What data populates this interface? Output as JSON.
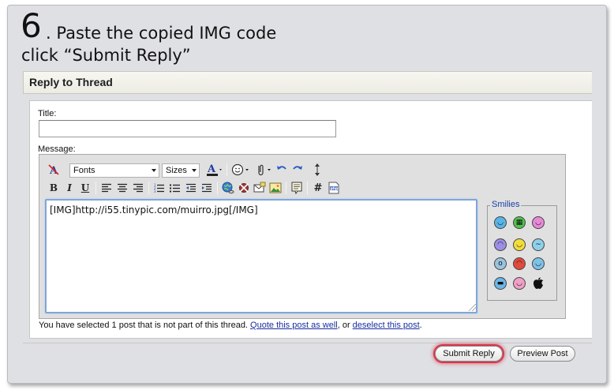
{
  "instruction": {
    "step_number": "6",
    "line1": ". Paste the copied IMG code",
    "line2": "click “Submit Reply”"
  },
  "panel": {
    "title": "Reply to Thread"
  },
  "form": {
    "title_label": "Title:",
    "title_value": "",
    "message_label": "Message:",
    "message_value": "[IMG]http://i55.tinypic.com/muirro.jpg[/IMG]"
  },
  "toolbar": {
    "font_select": "Fonts",
    "size_select": "Sizes",
    "bold": "B",
    "italic": "I",
    "underline": "U",
    "hash": "#"
  },
  "smilies": {
    "title": "Smilies",
    "items": [
      {
        "name": "smile",
        "color": "#5ab4e6",
        "glyph": "◡"
      },
      {
        "name": "grin",
        "color": "#4fc24f",
        "glyph": "▦"
      },
      {
        "name": "tongue",
        "color": "#e58ad6",
        "glyph": "◡"
      },
      {
        "name": "frown",
        "color": "#9b8fe6",
        "glyph": "◠"
      },
      {
        "name": "wink",
        "color": "#f2dd3b",
        "glyph": "◡"
      },
      {
        "name": "confused",
        "color": "#8ed0ea",
        "glyph": "~"
      },
      {
        "name": "eek",
        "color": "#9bc3de",
        "glyph": "o"
      },
      {
        "name": "mad",
        "color": "#e2493c",
        "glyph": "◠"
      },
      {
        "name": "rolleyes",
        "color": "#7ec2e8",
        "glyph": "◡"
      },
      {
        "name": "cool",
        "color": "#6cb6e8",
        "glyph": "▬"
      },
      {
        "name": "redface",
        "color": "#f1a0c8",
        "glyph": "◡"
      },
      {
        "name": "apple",
        "color": "#111111",
        "glyph": ""
      }
    ]
  },
  "notice": {
    "text_before": "You have selected 1 post that is not part of this thread. ",
    "link1": "Quote this post as well",
    "text_middle": ", or ",
    "link2": "deselect this post",
    "text_after": "."
  },
  "buttons": {
    "submit": "Submit Reply",
    "preview": "Preview Post"
  },
  "colors": {
    "focus_ring": "#d9364c",
    "link": "#1a2ea0",
    "textarea_border": "#7fa6d8"
  }
}
